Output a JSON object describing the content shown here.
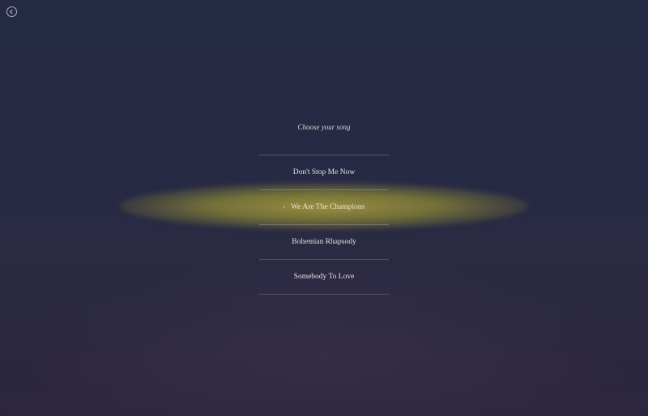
{
  "back": {
    "icon": "chevron-left-icon"
  },
  "title": "Choose your song",
  "songs": [
    {
      "label": "Don't Stop Me Now",
      "selected": false
    },
    {
      "label": "We Are The Champions",
      "selected": true
    },
    {
      "label": "Bohemian Rhapsody",
      "selected": false
    },
    {
      "label": "Somebody To Love",
      "selected": false
    }
  ],
  "selection_indicator": "›",
  "colors": {
    "background": "#252a45",
    "highlight": "#a0963c",
    "text": "#e6e4de"
  }
}
